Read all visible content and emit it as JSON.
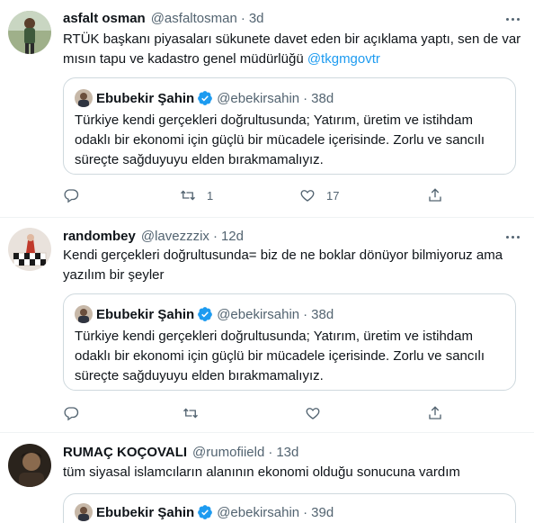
{
  "tweets": [
    {
      "name": "asfalt osman",
      "handle": "@asfaltosman",
      "dot": "·",
      "time": "3d",
      "text_pre": "RTÜK başkanı piyasaları sükunete davet eden bir açıklama yaptı, sen de var mısın tapu ve kadastro genel müdürlüğü ",
      "mention": "@tkgmgovtr",
      "reply_count": "",
      "retweet_count": "1",
      "like_count": "17"
    },
    {
      "name": "randombey",
      "handle": "@lavezzzix",
      "dot": "·",
      "time": "12d",
      "text": "Kendi gerçekleri doğrultusunda= biz de ne boklar dönüyor bilmiyoruz ama yazılım bir şeyler",
      "reply_count": "",
      "retweet_count": "",
      "like_count": ""
    },
    {
      "name": "RUMAÇ KOÇOVALI",
      "handle": "@rumofiield",
      "dot": "·",
      "time": "13d",
      "text": "tüm siyasal islamcıların alanının ekonomi olduğu sonucuna vardım"
    }
  ],
  "quotes": [
    {
      "name": "Ebubekir Şahin",
      "handle": "@ebekirsahin",
      "dot": "·",
      "time": "38d",
      "text": "Türkiye kendi gerçekleri doğrultusunda; Yatırım, üretim ve istihdam odaklı bir ekonomi için güçlü bir mücadele içerisinde. Zorlu ve sancılı süreçte sağduyuyu elden bırakmamalıyız."
    },
    {
      "name": "Ebubekir Şahin",
      "handle": "@ebekirsahin",
      "dot": "·",
      "time": "38d",
      "text": "Türkiye kendi gerçekleri doğrultusunda; Yatırım, üretim ve istihdam odaklı bir ekonomi için güçlü bir mücadele içerisinde. Zorlu ve sancılı süreçte sağduyuyu elden bırakmamalıyız."
    },
    {
      "name": "Ebubekir Şahin",
      "handle": "@ebekirsahin",
      "dot": "·",
      "time": "39d"
    }
  ],
  "icons": {
    "reply": "reply-icon",
    "retweet": "retweet-icon",
    "like": "like-icon",
    "share": "share-icon",
    "more": "more-icon",
    "verified": "verified-badge-icon"
  },
  "colors": {
    "accent": "#1d9bf0",
    "secondary_text": "#536471",
    "border": "#cfd9de",
    "divider": "#eff3f4"
  }
}
